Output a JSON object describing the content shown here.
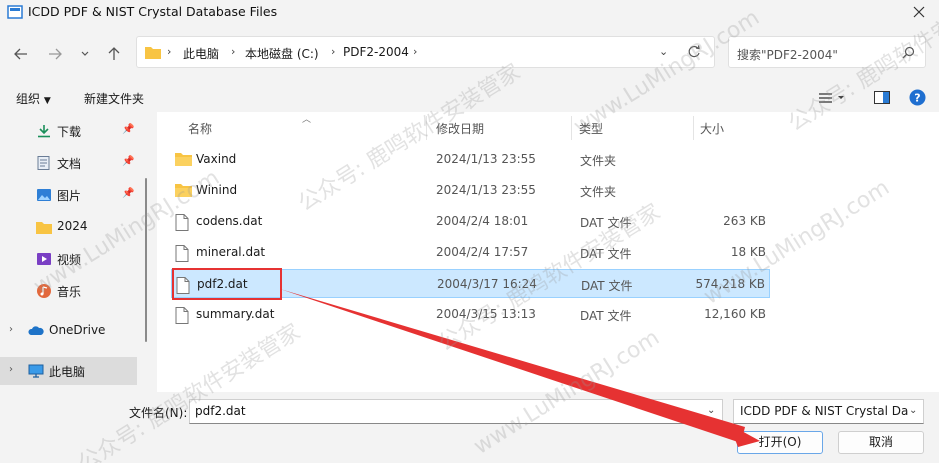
{
  "window": {
    "title": "ICDD PDF & NIST Crystal Database Files"
  },
  "address": {
    "segments": [
      "此电脑",
      "本地磁盘 (C:)",
      "PDF2-2004"
    ]
  },
  "search": {
    "placeholder": "搜索\"PDF2-2004\""
  },
  "toolbar": {
    "organize": "组织",
    "new_folder": "新建文件夹"
  },
  "sidebar": {
    "items": [
      {
        "label": "下载",
        "icon": "download-icon"
      },
      {
        "label": "文档",
        "icon": "document-icon"
      },
      {
        "label": "图片",
        "icon": "picture-icon"
      },
      {
        "label": "2024",
        "icon": "folder-icon"
      },
      {
        "label": "视频",
        "icon": "video-icon"
      },
      {
        "label": "音乐",
        "icon": "music-icon"
      },
      {
        "label": "OneDrive",
        "icon": "cloud-icon"
      },
      {
        "label": "此电脑",
        "icon": "computer-icon"
      }
    ]
  },
  "columns": {
    "name": "名称",
    "date": "修改日期",
    "type": "类型",
    "size": "大小"
  },
  "files": [
    {
      "name": "Vaxind",
      "date": "2024/1/13 23:55",
      "type": "文件夹",
      "size": "",
      "kind": "folder"
    },
    {
      "name": "Winind",
      "date": "2024/1/13 23:55",
      "type": "文件夹",
      "size": "",
      "kind": "folder"
    },
    {
      "name": "codens.dat",
      "date": "2004/2/4 18:01",
      "type": "DAT 文件",
      "size": "263 KB",
      "kind": "file"
    },
    {
      "name": "mineral.dat",
      "date": "2004/2/4 17:57",
      "type": "DAT 文件",
      "size": "18 KB",
      "kind": "file"
    },
    {
      "name": "pdf2.dat",
      "date": "2004/3/17 16:24",
      "type": "DAT 文件",
      "size": "574,218 KB",
      "kind": "file"
    },
    {
      "name": "summary.dat",
      "date": "2004/3/15 13:13",
      "type": "DAT 文件",
      "size": "12,160 KB",
      "kind": "file"
    }
  ],
  "bottom": {
    "filename_label": "文件名(N):",
    "filename_value": "pdf2.dat",
    "filetype_value": "ICDD PDF & NIST Crystal Da",
    "open_label": "打开(O)",
    "cancel_label": "取消"
  },
  "watermark": {
    "text": "公众号: 鹿鸣软件安装管家",
    "site": "www.LuMingRJ.com"
  }
}
